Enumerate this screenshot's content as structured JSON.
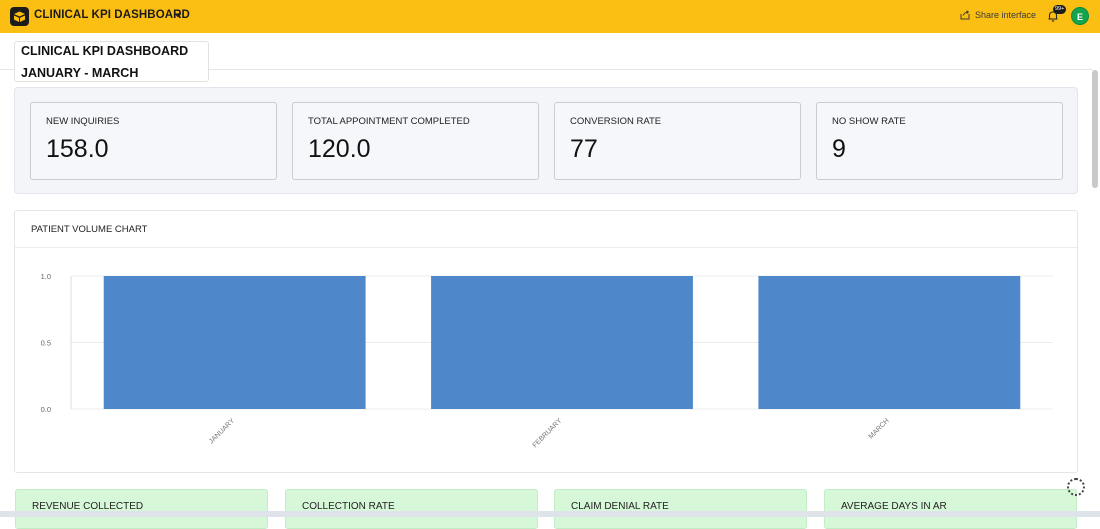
{
  "topbar": {
    "base_name": "CLINICAL KPI DASHBOARD",
    "share_label": "Share interface",
    "notification_count": "99+",
    "avatar_initial": "E",
    "brand_color": "#fbbf14"
  },
  "dashboard": {
    "title_line1": "CLINICAL KPI DASHBOARD",
    "title_line2": "JANUARY - MARCH"
  },
  "kpis": [
    {
      "label": "NEW INQUIRIES",
      "value": "158.0"
    },
    {
      "label": "TOTAL APPOINTMENT COMPLETED",
      "value": "120.0"
    },
    {
      "label": "CONVERSION RATE",
      "value": "77"
    },
    {
      "label": "NO SHOW RATE",
      "value": "9"
    }
  ],
  "chart": {
    "title": "PATIENT VOLUME CHART"
  },
  "chart_data": {
    "type": "bar",
    "categories": [
      "JANUARY",
      "FEBRUARY",
      "MARCH"
    ],
    "values": [
      1.0,
      1.0,
      1.0
    ],
    "ylim": [
      0,
      1
    ],
    "yticks": [
      "1.0",
      "0.5",
      "0.0"
    ],
    "bar_color": "#4f88ca",
    "grid": true
  },
  "bottom_cards": [
    {
      "label": "REVENUE COLLECTED"
    },
    {
      "label": "COLLECTION RATE"
    },
    {
      "label": "CLAIM DENIAL RATE"
    },
    {
      "label": "AVERAGE DAYS IN AR"
    }
  ]
}
